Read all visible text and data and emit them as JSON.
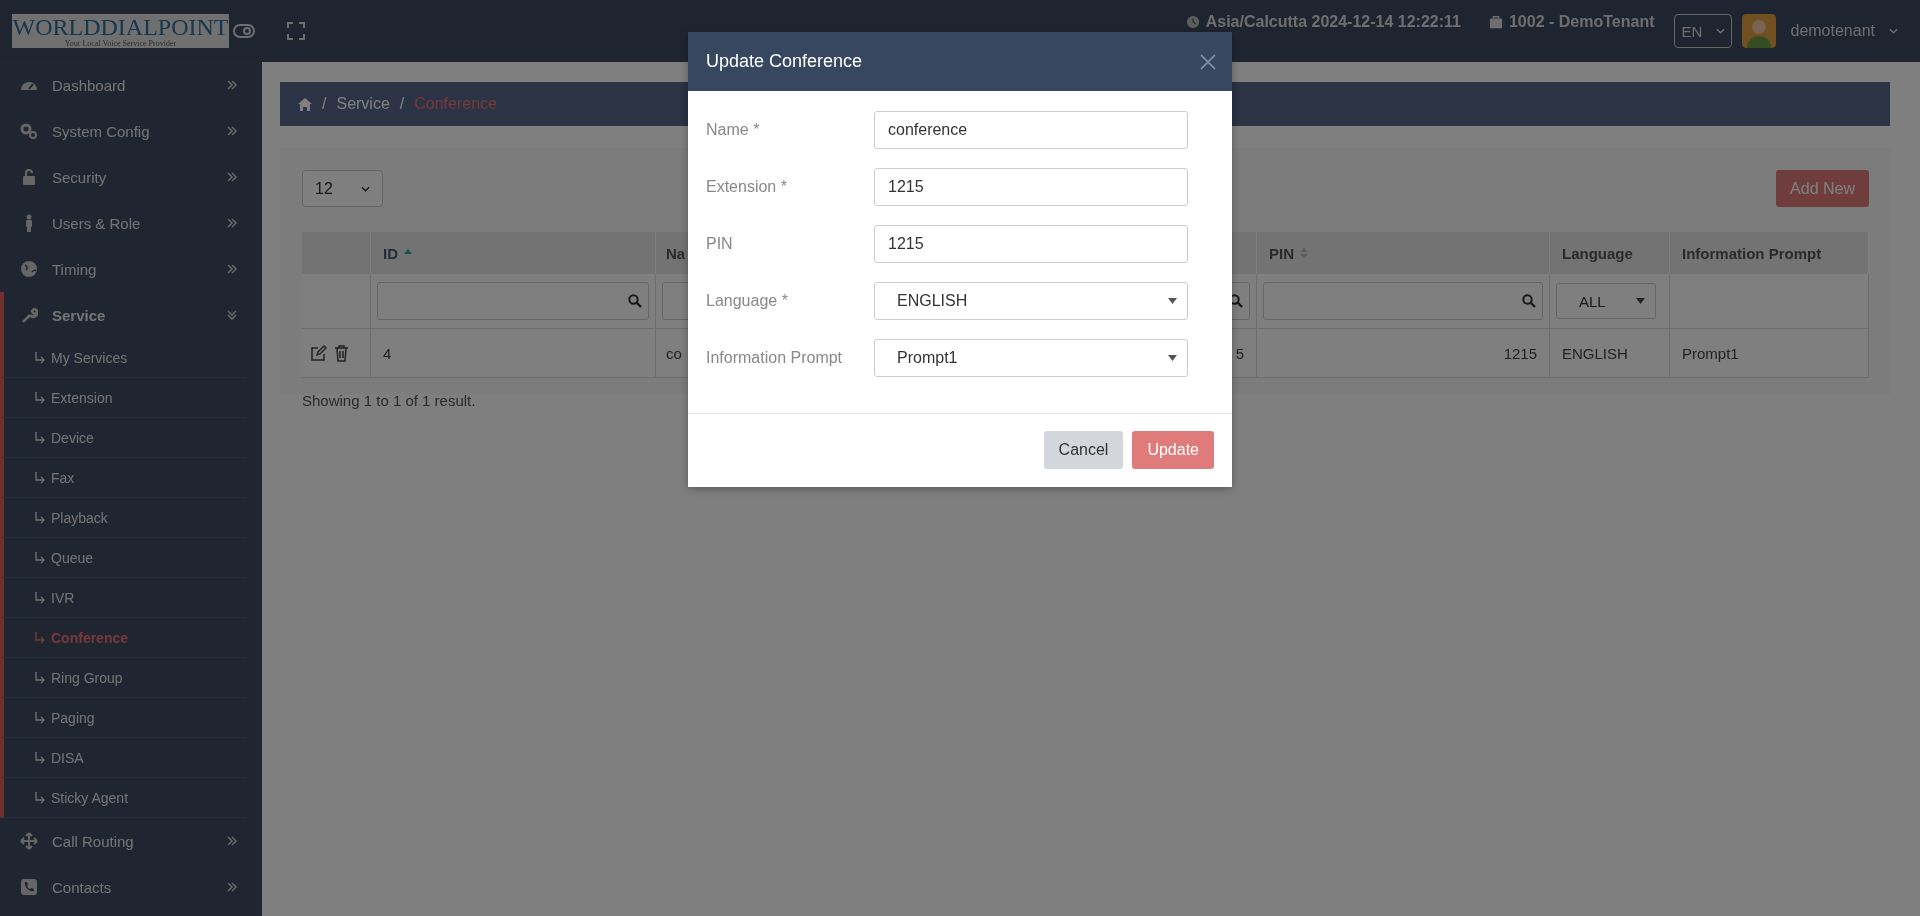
{
  "header": {
    "logo": {
      "title": "WORLDDIALPOINT",
      "tagline": "Your Local Voice Service Provider"
    },
    "timezone": "Asia/Calcutta 2024-12-14 12:22:11",
    "tenant": "1002 - DemoTenant",
    "language": "EN",
    "user": "demotenant"
  },
  "sidebar": {
    "items": [
      {
        "label": "Dashboard",
        "expanded": false
      },
      {
        "label": "System Config",
        "expanded": false
      },
      {
        "label": "Security",
        "expanded": false
      },
      {
        "label": "Users & Role",
        "expanded": false
      },
      {
        "label": "Timing",
        "expanded": false
      },
      {
        "label": "Service",
        "expanded": true,
        "children": [
          {
            "label": "My Services",
            "selected": false
          },
          {
            "label": "Extension",
            "selected": false
          },
          {
            "label": "Device",
            "selected": false
          },
          {
            "label": "Fax",
            "selected": false
          },
          {
            "label": "Playback",
            "selected": false
          },
          {
            "label": "Queue",
            "selected": false
          },
          {
            "label": "IVR",
            "selected": false
          },
          {
            "label": "Conference",
            "selected": true
          },
          {
            "label": "Ring Group",
            "selected": false
          },
          {
            "label": "Paging",
            "selected": false
          },
          {
            "label": "DISA",
            "selected": false
          },
          {
            "label": "Sticky Agent",
            "selected": false
          }
        ]
      },
      {
        "label": "Call Routing",
        "expanded": false
      },
      {
        "label": "Contacts",
        "expanded": false
      }
    ]
  },
  "breadcrumb": {
    "separator": "/",
    "items": [
      {
        "label": "Service",
        "current": false
      },
      {
        "label": "Conference",
        "current": true
      }
    ]
  },
  "page_size": "12",
  "add_button": "Add New",
  "table": {
    "columns": [
      {
        "kind": "actions"
      },
      {
        "kind": "data",
        "label": "ID",
        "sorted": true,
        "filter": {
          "kind": "text"
        }
      },
      {
        "kind": "data",
        "label": "Na",
        "filter": {
          "kind": "text"
        }
      },
      {
        "kind": "data",
        "filter": {
          "kind": "text"
        },
        "right_aligned": true
      },
      {
        "kind": "data",
        "label": "PIN",
        "sorted": false,
        "filter": {
          "kind": "text"
        },
        "right_aligned": true
      },
      {
        "kind": "data",
        "label": "Language",
        "filter": {
          "kind": "select",
          "value": "ALL"
        }
      },
      {
        "kind": "data",
        "label": "Information Prompt"
      }
    ],
    "rows": [
      {
        "cells": [
          "",
          "4",
          "co",
          "5",
          "1215",
          "ENGLISH",
          "Prompt1"
        ]
      }
    ]
  },
  "summary": "Showing 1 to 1 of 1 result.",
  "modal": {
    "title": "Update Conference",
    "fields": [
      {
        "kind": "text",
        "label": "Name *",
        "value": "conference"
      },
      {
        "kind": "text",
        "label": "Extension *",
        "value": "1215"
      },
      {
        "kind": "text",
        "label": "PIN",
        "value": "1215"
      },
      {
        "kind": "select",
        "label": "Language *",
        "value": "ENGLISH"
      },
      {
        "kind": "select",
        "label": "Information Prompt",
        "value": "Prompt1"
      }
    ],
    "buttons": [
      {
        "kind": "secondary",
        "label": "Cancel"
      },
      {
        "kind": "primary",
        "label": "Update"
      }
    ]
  }
}
